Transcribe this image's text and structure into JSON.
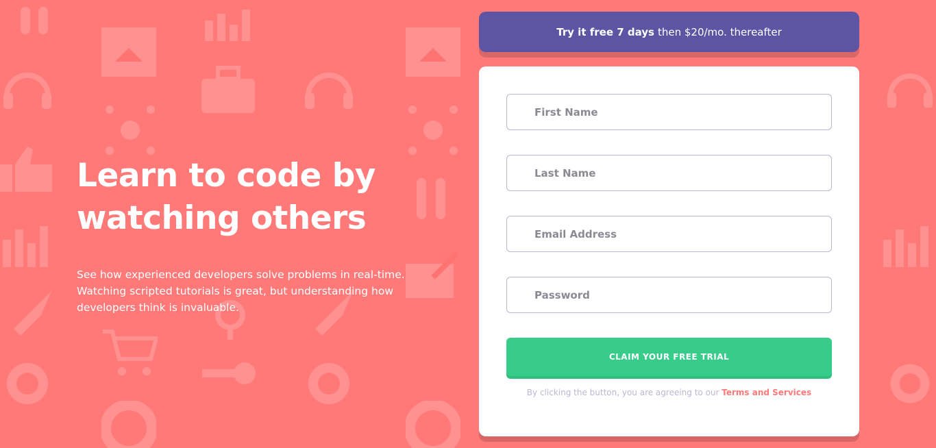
{
  "offer": {
    "bold": "Try it free 7 days",
    "rest": "then $20/mo. thereafter"
  },
  "hero": {
    "title": "Learn to code by watching others",
    "description": "See how experienced developers solve problems in real-time. Watching scripted tutorials is great, but understanding how developers think is invaluable."
  },
  "form": {
    "first_name_placeholder": "First Name",
    "last_name_placeholder": "Last Name",
    "email_placeholder": "Email Address",
    "password_placeholder": "Password",
    "submit_label": "CLAIM YOUR FREE TRIAL",
    "terms_prefix": "By clicking the button, you are agreeing to our",
    "terms_link": "Terms and Services"
  },
  "colors": {
    "background": "#ff7979",
    "accent_purple": "#5e54a4",
    "accent_green": "#38cc8b",
    "text_dark": "#3d3b48",
    "text_muted": "#bab7d4"
  },
  "background_icons": [
    "link-icon",
    "browser-window-icon",
    "bar-chart-icon",
    "headset-icon",
    "network-icon",
    "toolbox-icon",
    "thumbs-up-icon",
    "rocket-icon",
    "shopping-cart-icon",
    "globe-gear-icon",
    "key-icon",
    "life-ring-icon",
    "magnifier-icon",
    "pencil-icon"
  ]
}
